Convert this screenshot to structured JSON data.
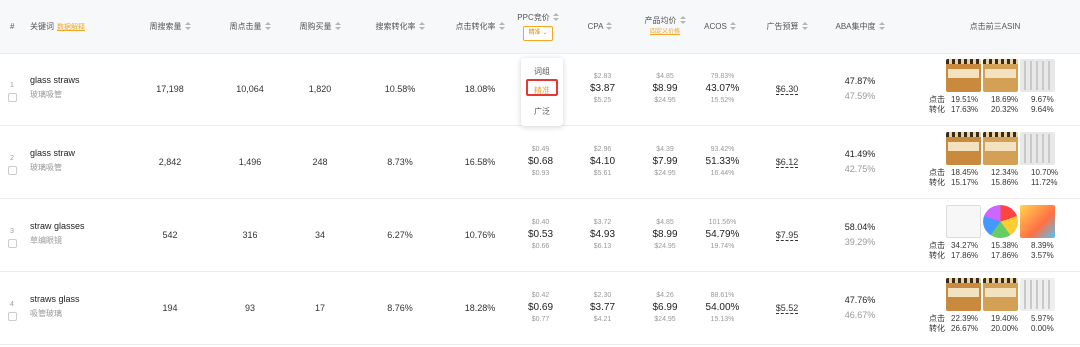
{
  "header": {
    "index": "#",
    "keyword": "关键词",
    "keyword_link": "数据解释",
    "weekly_search": "周搜索量",
    "weekly_clicks": "周点击量",
    "weekly_purchases": "周购买量",
    "search_cvr": "搜索转化率",
    "click_cvr": "点击转化率",
    "ppc": "PPC竞价",
    "ppc_mode": "精准",
    "cpa": "CPA",
    "avg_price": "产品均价",
    "avg_price_link": "四定义价格",
    "acos": "ACOS",
    "ad_budget": "广告预算",
    "aba": "ABA集中度",
    "top3": "点击前三ASIN"
  },
  "dropdown": {
    "items": [
      "词组",
      "精准",
      "广泛"
    ],
    "selected": "精准"
  },
  "stat_labels": {
    "click": "点击",
    "conv": "转化"
  },
  "rows": [
    {
      "index": "1",
      "keyword": "glass straws",
      "keyword_cn": "玻璃吸管",
      "weekly_search": "17,198",
      "weekly_clicks": "10,064",
      "weekly_purchases": "1,820",
      "search_cvr": "10.58%",
      "click_cvr": "18.08%",
      "ppc": {
        "low": "",
        "mid": "",
        "high": ""
      },
      "cpa": {
        "low": "$2.83",
        "mid": "$3.87",
        "high": "$5.25"
      },
      "price": {
        "low": "$4.85",
        "mid": "$8.99",
        "high": "$24.95"
      },
      "acos": {
        "low": "79.83%",
        "mid": "43.07%",
        "high": "15.52%"
      },
      "budget": "$6.30",
      "aba": {
        "main": "47.87%",
        "sub": "47.59%"
      },
      "click": [
        "19.51%",
        "18.69%",
        "9.67%"
      ],
      "conv": [
        "17.63%",
        "20.32%",
        "9.64%"
      ],
      "thumb_colors": [
        "#c98a3e",
        "#d4a055",
        "#e8e8e8"
      ]
    },
    {
      "index": "2",
      "keyword": "glass straw",
      "keyword_cn": "玻璃吸管",
      "weekly_search": "2,842",
      "weekly_clicks": "1,496",
      "weekly_purchases": "248",
      "search_cvr": "8.73%",
      "click_cvr": "16.58%",
      "ppc": {
        "low": "$0.49",
        "mid": "$0.68",
        "high": "$0.93"
      },
      "cpa": {
        "low": "$2.96",
        "mid": "$4.10",
        "high": "$5.61"
      },
      "price": {
        "low": "$4.39",
        "mid": "$7.99",
        "high": "$24.95"
      },
      "acos": {
        "low": "93.42%",
        "mid": "51.33%",
        "high": "16.44%"
      },
      "budget": "$6.12",
      "aba": {
        "main": "41.49%",
        "sub": "42.75%"
      },
      "click": [
        "18.45%",
        "12.34%",
        "10.70%"
      ],
      "conv": [
        "15.17%",
        "15.86%",
        "11.72%"
      ],
      "thumb_colors": [
        "#c98a3e",
        "#d4a055",
        "#e8e8e8"
      ]
    },
    {
      "index": "3",
      "keyword": "straw glasses",
      "keyword_cn": "草编眼镜",
      "weekly_search": "542",
      "weekly_clicks": "316",
      "weekly_purchases": "34",
      "search_cvr": "6.27%",
      "click_cvr": "10.76%",
      "ppc": {
        "low": "$0.40",
        "mid": "$0.53",
        "high": "$0.66"
      },
      "cpa": {
        "low": "$3.72",
        "mid": "$4.93",
        "high": "$6.13"
      },
      "price": {
        "low": "$4.85",
        "mid": "$8.99",
        "high": "$24.95"
      },
      "acos": {
        "low": "101.56%",
        "mid": "54.79%",
        "high": "19.74%"
      },
      "budget": "$7.95",
      "aba": {
        "main": "58.04%",
        "sub": "39.29%"
      },
      "click": [
        "34.27%",
        "15.38%",
        "8.39%"
      ],
      "conv": [
        "17.86%",
        "17.86%",
        "3.57%"
      ],
      "thumb_colors": [
        "#f0f0f0",
        "#7cc36e",
        "#f2c94c"
      ]
    },
    {
      "index": "4",
      "keyword": "straws glass",
      "keyword_cn": "吸管玻璃",
      "weekly_search": "194",
      "weekly_clicks": "93",
      "weekly_purchases": "17",
      "search_cvr": "8.76%",
      "click_cvr": "18.28%",
      "ppc": {
        "low": "$0.42",
        "mid": "$0.69",
        "high": "$0.77"
      },
      "cpa": {
        "low": "$2.30",
        "mid": "$3.77",
        "high": "$4.21"
      },
      "price": {
        "low": "$4.26",
        "mid": "$6.99",
        "high": "$24.95"
      },
      "acos": {
        "low": "88.61%",
        "mid": "54.00%",
        "high": "15.13%"
      },
      "budget": "$5.52",
      "aba": {
        "main": "47.76%",
        "sub": "46.67%"
      },
      "click": [
        "22.39%",
        "19.40%",
        "5.97%"
      ],
      "conv": [
        "26.67%",
        "20.00%",
        "0.00%"
      ],
      "thumb_colors": [
        "#c98a3e",
        "#d4a055",
        "#eeeeee"
      ]
    }
  ]
}
